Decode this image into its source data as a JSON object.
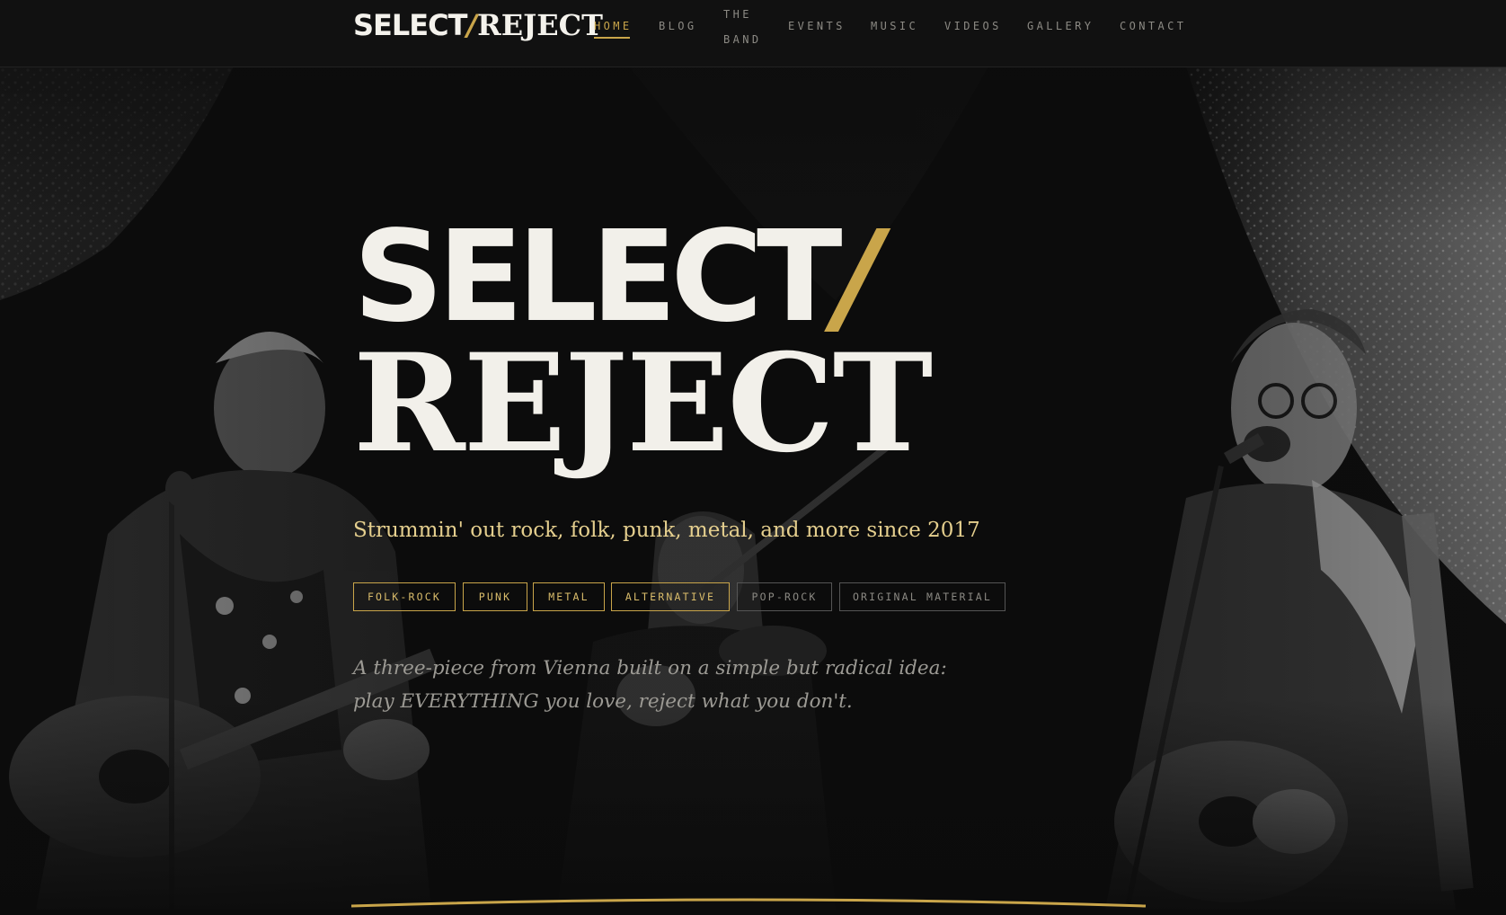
{
  "header": {
    "logo": {
      "part1": "SELECT",
      "slash": "/",
      "part2": "REJECT"
    },
    "nav": [
      {
        "label": "HOME",
        "active": true
      },
      {
        "label": "BLOG"
      },
      {
        "label": "THE",
        "label2": "BAND"
      },
      {
        "label": "EVENTS"
      },
      {
        "label": "MUSIC"
      },
      {
        "label": "VIDEOS"
      },
      {
        "label": "GALLERY"
      },
      {
        "label": "CONTACT"
      }
    ]
  },
  "hero": {
    "title_line1": "SELECT",
    "title_slash": "/",
    "title_line2": "REJECT",
    "tagline": "Strummin' out rock, folk, punk, metal, and more since 2017",
    "tags": [
      {
        "label": "FOLK-ROCK",
        "style": "accent"
      },
      {
        "label": "PUNK",
        "style": "accent"
      },
      {
        "label": "METAL",
        "style": "accent"
      },
      {
        "label": "ALTERNATIVE",
        "style": "accent"
      },
      {
        "label": "POP-ROCK",
        "style": "dim"
      },
      {
        "label": "ORIGINAL MATERIAL",
        "style": "dim"
      }
    ],
    "description": "A three-piece from Vienna built on a simple but radical idea: play EVERYTHING you love, reject what you don't."
  },
  "colors": {
    "accent": "#c9a54a",
    "background": "#0b0b0b",
    "text": "#f2f0ea",
    "tagline": "#e5cf8e"
  }
}
